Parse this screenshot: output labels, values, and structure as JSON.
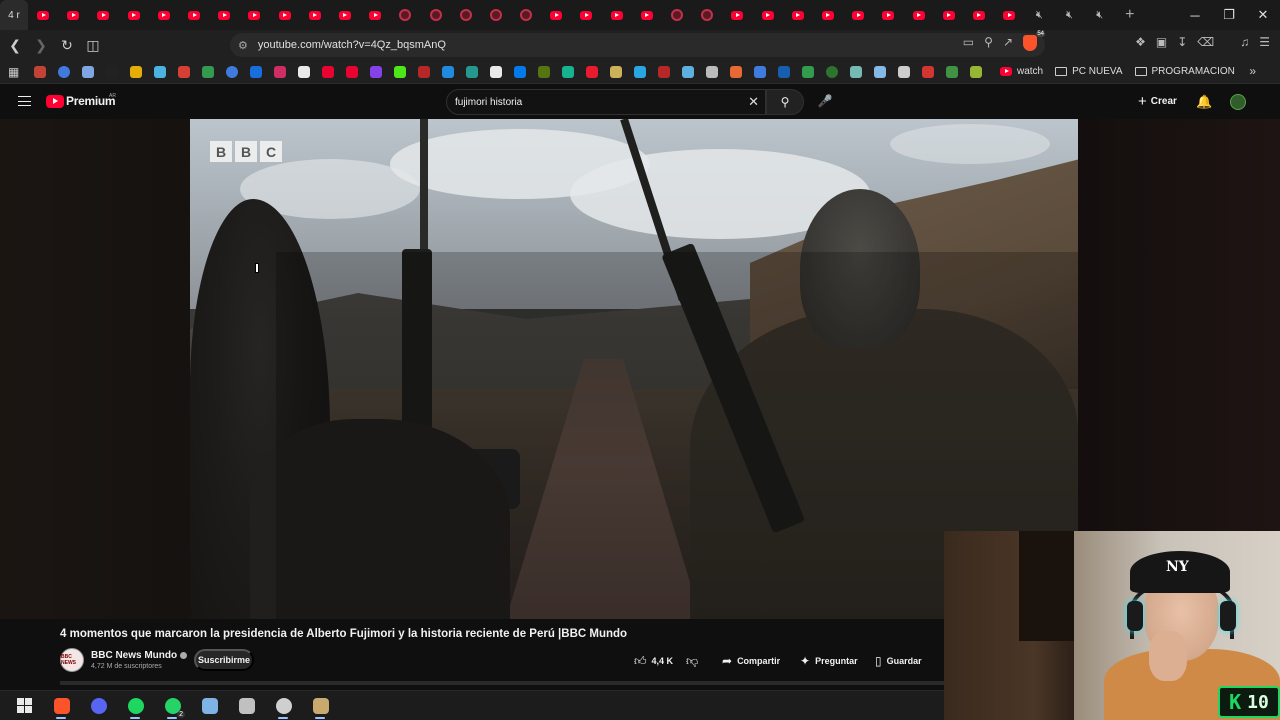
{
  "browser": {
    "active_tab_title": "4 r",
    "tabs": [
      "yt",
      "yt",
      "yt",
      "yt",
      "yt",
      "yt",
      "yt",
      "yt",
      "yt",
      "yt",
      "yt",
      "yt",
      "rec",
      "rec",
      "rec",
      "rec",
      "rec",
      "yt",
      "yt",
      "yt",
      "yt",
      "rec",
      "rec",
      "yt",
      "yt",
      "yt",
      "yt",
      "yt",
      "yt",
      "yt",
      "yt",
      "yt",
      "yt",
      "mute",
      "mute",
      "mute"
    ],
    "new_tab_label": "+",
    "window_controls": {
      "minimize": "─",
      "restore": "❐",
      "close": "✕"
    },
    "url": "youtube.com/watch?v=4Qz_bqsmAnQ",
    "bookmarks": [
      {
        "icon": "gmail-icon",
        "color": "#d44638"
      },
      {
        "icon": "google-icon",
        "color": "#4285f4"
      },
      {
        "icon": "gemini-icon",
        "color": "#8ab4f8"
      },
      {
        "icon": "twitch-tracker-icon",
        "color": "#222222"
      },
      {
        "icon": "keep-icon",
        "color": "#fbbc04"
      },
      {
        "icon": "cloud-icon",
        "color": "#4fc3f7"
      },
      {
        "icon": "mail-icon",
        "color": "#ea4335"
      },
      {
        "icon": "maps-icon",
        "color": "#34a853"
      },
      {
        "icon": "chrome-icon",
        "color": "#4285f4"
      },
      {
        "icon": "facebook-icon",
        "color": "#1877f2"
      },
      {
        "icon": "instagram-icon",
        "color": "#e1306c"
      },
      {
        "icon": "x-icon",
        "color": "#ffffff"
      },
      {
        "icon": "youtube-icon",
        "color": "#ff0033"
      },
      {
        "icon": "youtube-music-icon",
        "color": "#ff0033"
      },
      {
        "icon": "twitch-icon",
        "color": "#9146ff"
      },
      {
        "icon": "kick-icon",
        "color": "#53fc18"
      },
      {
        "icon": "bookmark-red-icon",
        "color": "#c62828"
      },
      {
        "icon": "play-blue-icon",
        "color": "#2196f3"
      },
      {
        "icon": "chart-icon",
        "color": "#26a69a"
      },
      {
        "icon": "tiktok-icon",
        "color": "#ffffff"
      },
      {
        "icon": "messenger-icon",
        "color": "#0084ff"
      },
      {
        "icon": "steam-icon",
        "color": "#5c7e10"
      },
      {
        "icon": "grammarly-icon",
        "color": "#15c39a"
      },
      {
        "icon": "opera-icon",
        "color": "#ff1b2d"
      },
      {
        "icon": "pill-icon",
        "color": "#e0c060"
      },
      {
        "icon": "cloud-blue-icon",
        "color": "#29b6f6"
      },
      {
        "icon": "youtube-studio-icon",
        "color": "#c62828"
      },
      {
        "icon": "steam-dark-icon",
        "color": "#66c0f4"
      },
      {
        "icon": "github-icon",
        "color": "#cccccc"
      },
      {
        "icon": "fox-icon",
        "color": "#ff7139"
      },
      {
        "icon": "calendar-icon",
        "color": "#4285f4"
      },
      {
        "icon": "nasa-icon",
        "color": "#1565c0"
      },
      {
        "icon": "sheets-icon",
        "color": "#34a853"
      },
      {
        "icon": "green-circle-icon",
        "color": "#2e7d32"
      },
      {
        "icon": "arc-icon",
        "color": "#80cbc4"
      },
      {
        "icon": "globe-icon",
        "color": "#90caf9"
      },
      {
        "icon": "diamond-icon",
        "color": "#e0e0e0"
      },
      {
        "icon": "ai-icon",
        "color": "#e53935"
      },
      {
        "icon": "book-icon",
        "color": "#43a047"
      },
      {
        "icon": "android-icon",
        "color": "#a4c639"
      }
    ],
    "bookmark_watch_label": "watch",
    "bookmark_folders": [
      "PC NUEVA",
      "PROGRAMACION"
    ],
    "more_bookmarks": "»"
  },
  "youtube": {
    "logo_text": "Premium",
    "region_code": "AR",
    "search_value": "fujimori historia",
    "create_label": "Crear",
    "video": {
      "watermark_letters": [
        "B",
        "B",
        "C"
      ],
      "title": "4 momentos que marcaron la presidencia de Alberto Fujimori y la historia reciente de Perú |BBC Mundo",
      "channel_name": "BBC News Mundo",
      "channel_avatar_text": "BBC NEWS",
      "subscribers": "4,72 M de suscriptores",
      "subscribe_label": "Suscribirme",
      "likes": "4,4 K",
      "share_label": "Compartir",
      "ask_label": "Preguntar",
      "save_label": "Guardar"
    }
  },
  "overlay": {
    "cap_logo": "NY",
    "counter_letter": "K",
    "counter_value": "10"
  },
  "taskbar": {
    "apps": [
      {
        "icon": "windows-start-icon",
        "color": "#eaeaea"
      },
      {
        "icon": "brave-icon",
        "color": "#fb542b"
      },
      {
        "icon": "discord-icon",
        "color": "#5865f2"
      },
      {
        "icon": "spotify-icon",
        "color": "#1ed760"
      },
      {
        "icon": "whatsapp-icon",
        "color": "#25d366"
      },
      {
        "icon": "notepad-icon",
        "color": "#7fb2e5"
      },
      {
        "icon": "paint-icon",
        "color": "#c0c0c0"
      },
      {
        "icon": "obs-icon",
        "color": "#cfcfcf"
      },
      {
        "icon": "league-icon",
        "color": "#c8aa6e"
      }
    ],
    "whatsapp_badge": "2"
  }
}
